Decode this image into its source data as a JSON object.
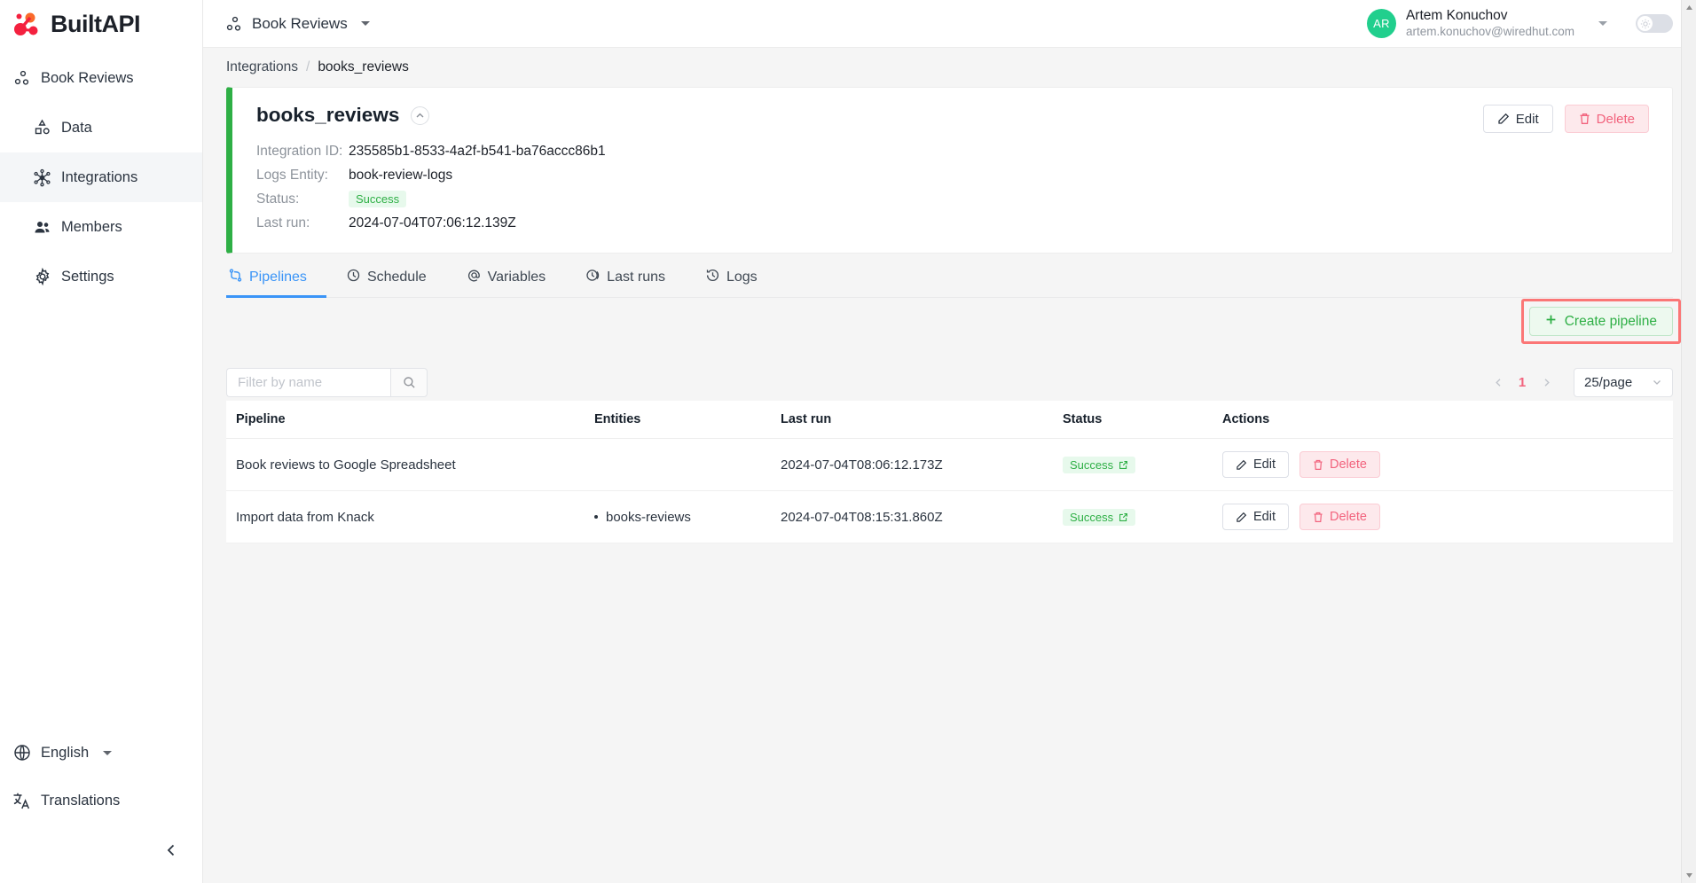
{
  "brand": {
    "name": "BuiltAPI"
  },
  "sidebar": {
    "workspace": {
      "label": "Book Reviews",
      "icon": "nodes-icon"
    },
    "items": [
      {
        "label": "Data",
        "icon": "shapes-icon"
      },
      {
        "label": "Integrations",
        "icon": "network-icon",
        "active": true
      },
      {
        "label": "Members",
        "icon": "people-icon"
      },
      {
        "label": "Settings",
        "icon": "gear-icon"
      }
    ],
    "language": {
      "label": "English",
      "icon": "globe-icon"
    },
    "translations": {
      "label": "Translations",
      "icon": "translate-icon"
    },
    "collapse": {
      "icon": "chevron-left-icon"
    }
  },
  "topbar": {
    "workspace": "Book Reviews",
    "user": {
      "initials": "AR",
      "name": "Artem Konuchov",
      "email": "artem.konuchov@wiredhut.com"
    },
    "theme_toggle": {
      "icon": "sun-icon",
      "state": "off"
    }
  },
  "breadcrumb": {
    "parent": "Integrations",
    "separator": "/",
    "current": "books_reviews"
  },
  "card": {
    "title": "books_reviews",
    "accent_color": "#2eaf45",
    "collapse_icon": "chevron-up-icon",
    "edit_label": "Edit",
    "delete_label": "Delete",
    "fields": [
      {
        "label": "Integration ID:",
        "value": "235585b1-8533-4a2f-b541-ba76accc86b1",
        "type": "text"
      },
      {
        "label": "Logs Entity:",
        "value": "book-review-logs",
        "type": "text"
      },
      {
        "label": "Status:",
        "value": "Success",
        "type": "badge"
      },
      {
        "label": "Last run:",
        "value": "2024-07-04T07:06:12.139Z",
        "type": "text"
      }
    ]
  },
  "tabs": [
    {
      "label": "Pipelines",
      "icon": "pipeline-icon",
      "active": true
    },
    {
      "label": "Schedule",
      "icon": "clock-icon",
      "active": false
    },
    {
      "label": "Variables",
      "icon": "at-icon",
      "active": false
    },
    {
      "label": "Last runs",
      "icon": "history-icon",
      "active": false
    },
    {
      "label": "Logs",
      "icon": "time-icon",
      "active": false
    }
  ],
  "toolbar": {
    "create_label": "Create pipeline",
    "create_icon": "plus-icon",
    "highlight_color": "#fb7676"
  },
  "filter": {
    "placeholder": "Filter by name",
    "value": "",
    "search_icon": "search-icon"
  },
  "pagination": {
    "prev_icon": "chevron-left-icon",
    "next_icon": "chevron-right-icon",
    "current_page": "1",
    "page_size": "25/page",
    "page_size_icon": "chevron-down-icon"
  },
  "table": {
    "columns": [
      "Pipeline",
      "Entities",
      "Last run",
      "Status",
      "Actions"
    ],
    "rows": [
      {
        "pipeline": "Book reviews to Google Spreadsheet",
        "entities": [],
        "last_run": "2024-07-04T08:06:12.173Z",
        "status": "Success",
        "edit_label": "Edit",
        "delete_label": "Delete"
      },
      {
        "pipeline": "Import data from Knack",
        "entities": [
          "books-reviews"
        ],
        "last_run": "2024-07-04T08:15:31.860Z",
        "status": "Success",
        "edit_label": "Edit",
        "delete_label": "Delete"
      }
    ]
  }
}
